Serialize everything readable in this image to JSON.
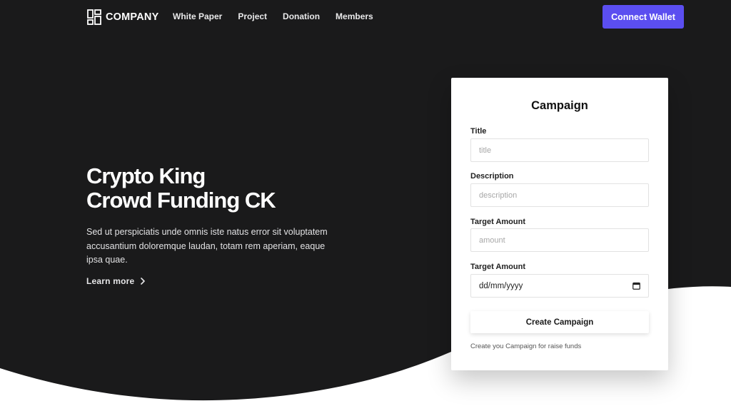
{
  "header": {
    "brand": "COMPANY",
    "nav": [
      {
        "label": "White Paper"
      },
      {
        "label": "Project"
      },
      {
        "label": "Donation"
      },
      {
        "label": "Members"
      }
    ],
    "connect_label": "Connect Wallet"
  },
  "hero": {
    "title_line1": "Crypto King",
    "title_line2": "Crowd Funding CK",
    "description": "Sed ut perspiciatis unde omnis iste natus error sit voluptatem accusantium doloremque laudan, totam rem aperiam, eaque ipsa quae.",
    "learn_more": "Learn more"
  },
  "campaign": {
    "heading": "Campaign",
    "title_label": "Title",
    "title_placeholder": "title",
    "description_label": "Description",
    "description_placeholder": "description",
    "amount_label": "Target Amount",
    "amount_placeholder": "amount",
    "date_label": "Target Amount",
    "date_placeholder": "dd/mm/yyyy",
    "submit_label": "Create Campaign",
    "helper": "Create you Campaign for raise funds"
  },
  "colors": {
    "background_dark": "#1a1a1b",
    "accent": "#5b4ef0",
    "card": "#ffffff"
  },
  "icons": {
    "logo": "grid-layout-icon",
    "learn_more": "chevron-right-icon",
    "date": "calendar-icon"
  }
}
